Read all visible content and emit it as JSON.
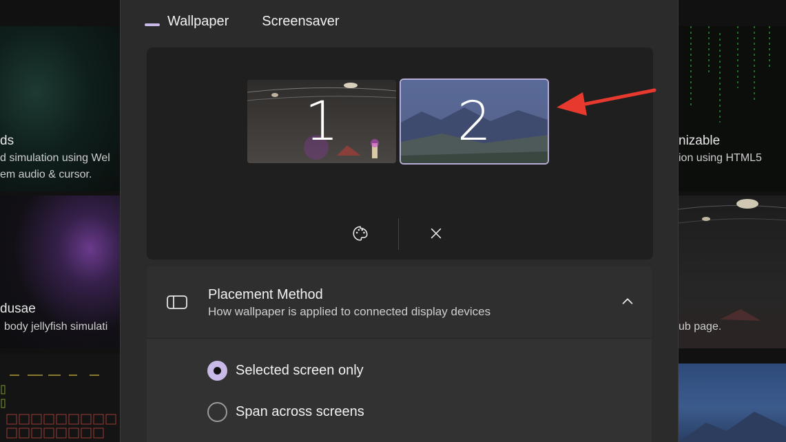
{
  "background_tiles": [
    {
      "title": "ds",
      "desc_lines": [
        "d simulation using Wel",
        "em audio & cursor."
      ]
    },
    {
      "title": "dusae",
      "desc_lines": [
        "body jellyfish simulati"
      ]
    },
    {
      "title": "nizable",
      "desc_lines": [
        "ion using HTML5"
      ]
    },
    {
      "title": "",
      "desc_lines": [
        "ub page."
      ]
    }
  ],
  "tabs": [
    {
      "label": "Wallpaper",
      "active": true
    },
    {
      "label": "Screensaver",
      "active": false
    }
  ],
  "monitors": [
    {
      "number": "1",
      "selected": false
    },
    {
      "number": "2",
      "selected": true
    }
  ],
  "panel_actions": {
    "palette": "palette-icon",
    "close": "close-icon"
  },
  "placement": {
    "title": "Placement Method",
    "subtitle": "How wallpaper is applied to connected display devices",
    "icon": "display-panel-icon",
    "expanded": true,
    "options": [
      {
        "label": "Selected screen only",
        "checked": true
      },
      {
        "label": "Span across screens",
        "checked": false
      }
    ]
  },
  "colors": {
    "accent": "#c8b9e8",
    "annotation_arrow": "#e8392f",
    "dialog_bg": "#2b2b2b",
    "panel_bg": "#1f1f1f"
  }
}
